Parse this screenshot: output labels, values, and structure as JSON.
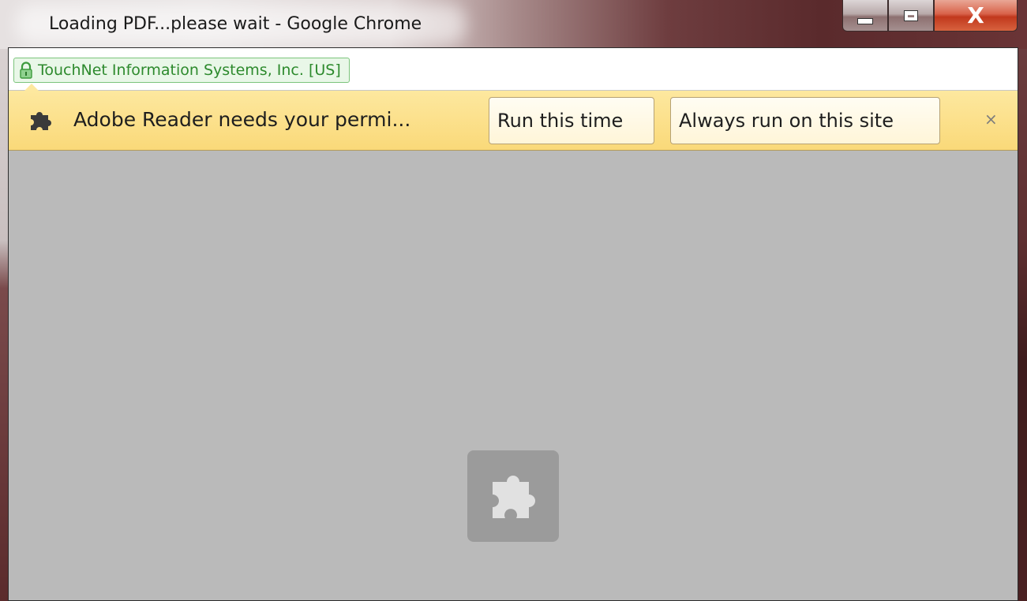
{
  "window": {
    "title": "Loading PDF...please wait - Google Chrome",
    "close_glyph": "X"
  },
  "urlbar": {
    "site_identity": "TouchNet Information Systems, Inc. [US]",
    "icon": "lock-icon"
  },
  "infobar": {
    "icon": "puzzle-icon",
    "message": "Adobe Reader needs your permi...",
    "run_button": "Run this time",
    "always_button": "Always run on this site",
    "close_glyph": "×"
  },
  "content": {
    "placeholder_icon": "plugin-puzzle-icon"
  },
  "colors": {
    "infobar_bg": "#fad979",
    "secure_green": "#2d8a2d",
    "content_bg": "#bababa",
    "close_button_red": "#c1381d"
  }
}
